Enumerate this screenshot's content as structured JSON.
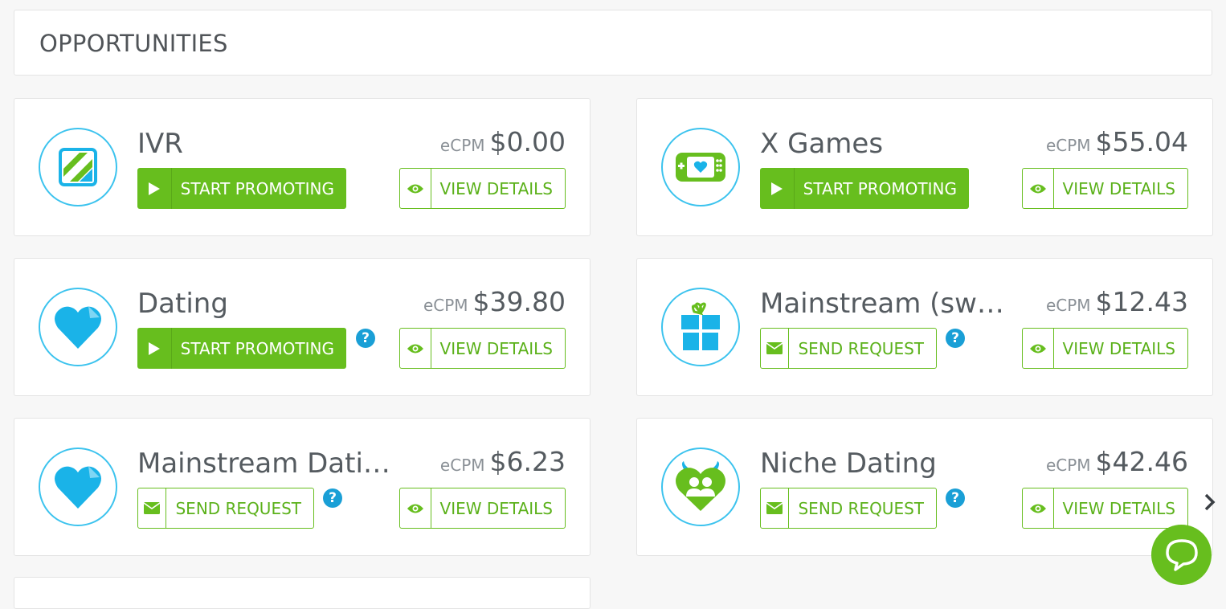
{
  "header": {
    "title": "OPPORTUNITIES"
  },
  "labels": {
    "ecpm": "eCPM",
    "start_promoting": "START PROMOTING",
    "send_request": "SEND REQUEST",
    "view_details": "VIEW DETAILS",
    "help": "?"
  },
  "offers": [
    {
      "name": "IVR",
      "ecpm": "$0.00",
      "action": "start_promoting",
      "icon": "ivr-icon"
    },
    {
      "name": "X Games",
      "ecpm": "$55.04",
      "action": "start_promoting",
      "icon": "game-controller-icon"
    },
    {
      "name": "Dating",
      "ecpm": "$39.80",
      "action": "start_promoting",
      "icon": "heart-icon"
    },
    {
      "name": "Mainstream (sw…",
      "ecpm": "$12.43",
      "action": "send_request",
      "icon": "gift-icon"
    },
    {
      "name": "Mainstream Dati…",
      "ecpm": "$6.23",
      "action": "send_request",
      "icon": "heart-icon"
    },
    {
      "name": "Niche Dating",
      "ecpm": "$42.46",
      "action": "send_request",
      "icon": "devil-heart-icon"
    }
  ],
  "colors": {
    "accent": "#67be1e",
    "icon_blue": "#3cc3ee",
    "help_blue": "#1a9fd6"
  }
}
